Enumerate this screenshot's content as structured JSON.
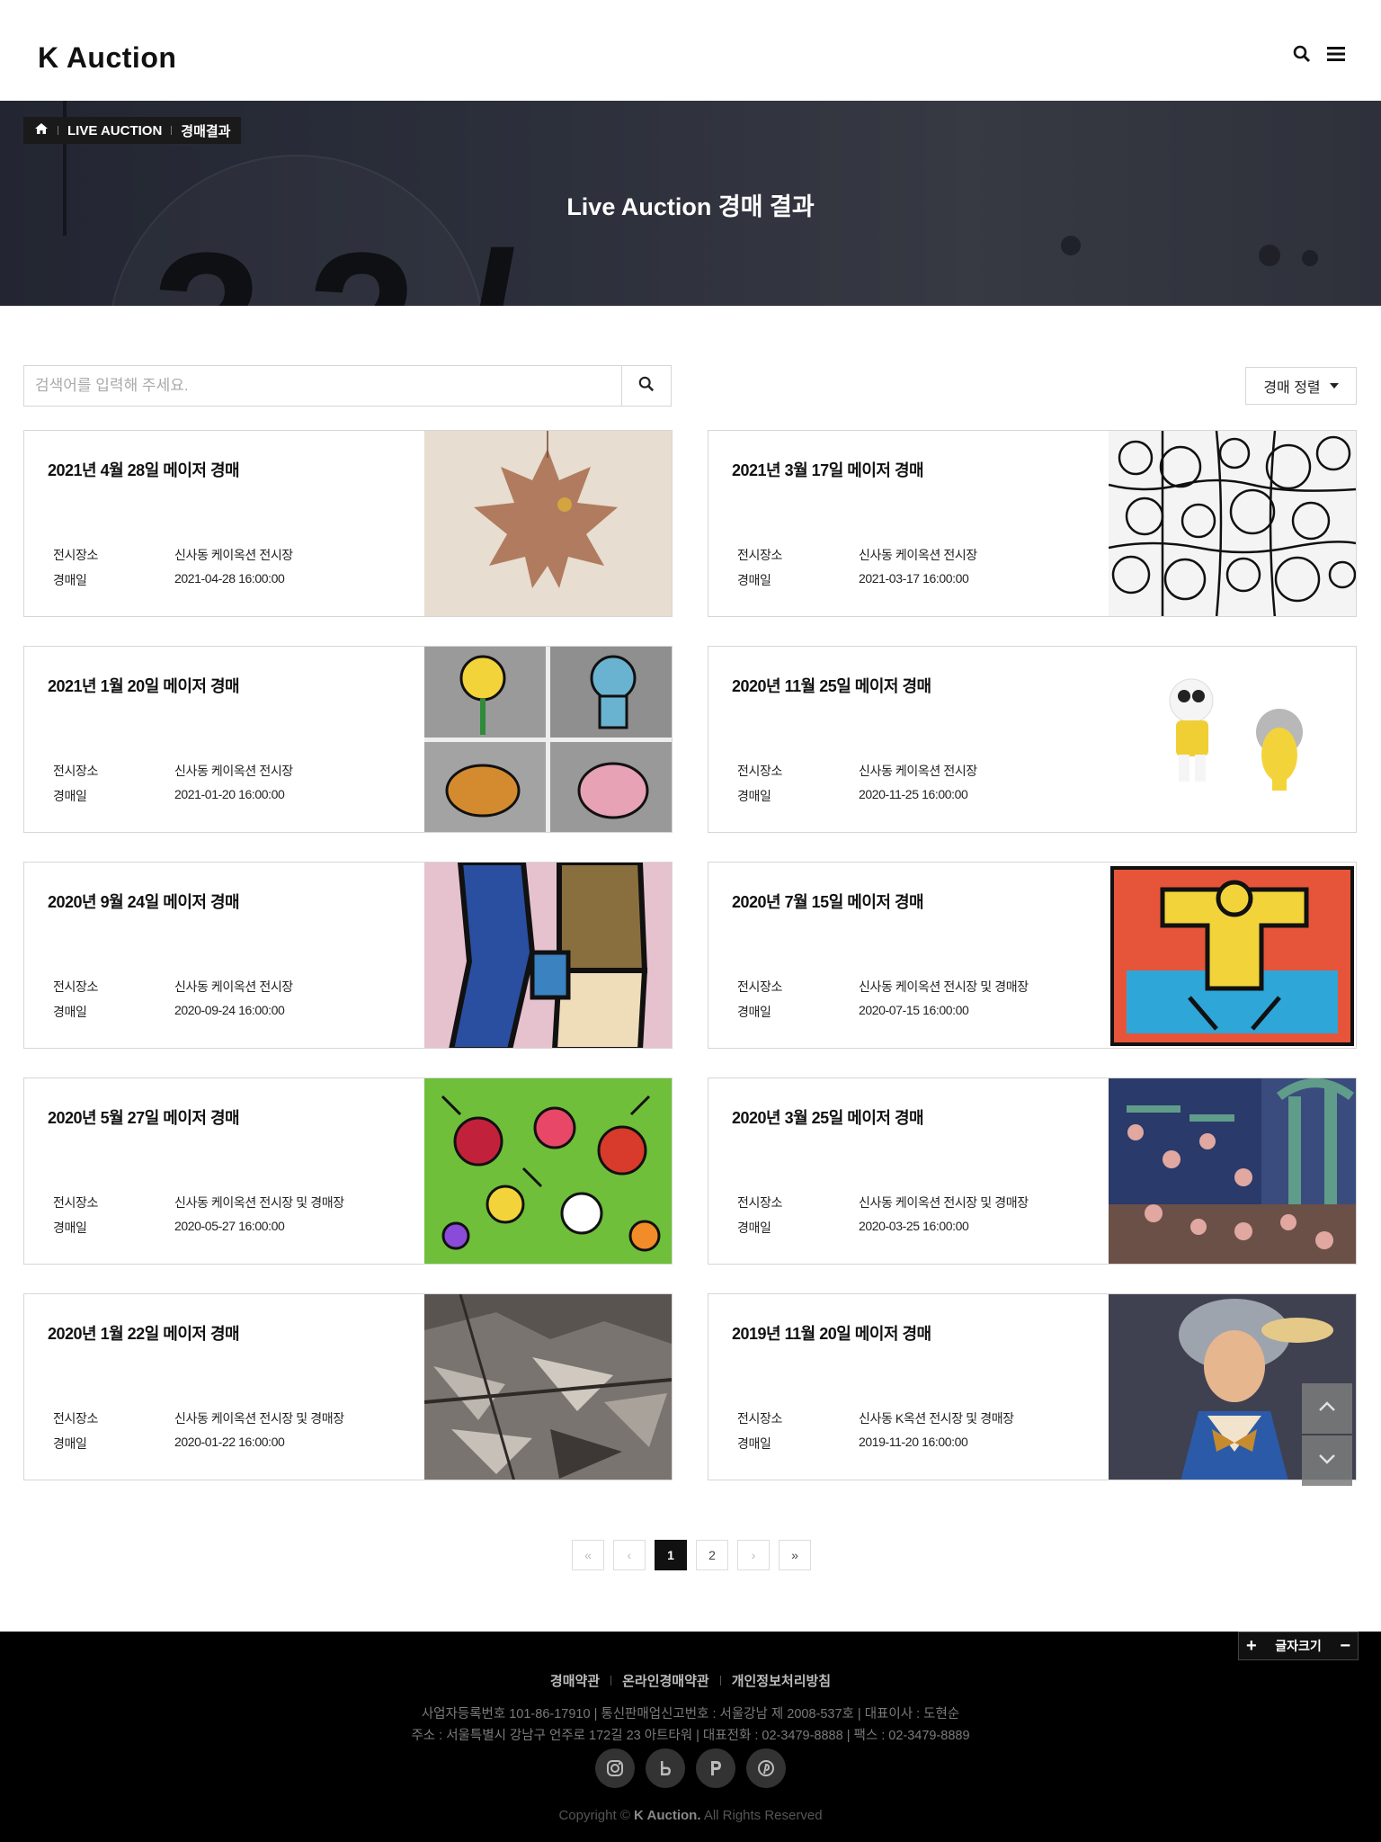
{
  "header": {
    "logo": "K Auction",
    "search_icon": "search-icon",
    "menu_icon": "hamburger-menu-icon"
  },
  "hero": {
    "breadcrumb": [
      "LIVE AUCTION",
      "경매결과"
    ],
    "home_icon": "home-icon",
    "title": "Live Auction 경매 결과"
  },
  "search": {
    "placeholder": "검색어를 입력해 주세요.",
    "button_icon": "search-icon"
  },
  "sort": {
    "label": "경매 정렬"
  },
  "labels": {
    "venue": "전시장소",
    "date": "경매일"
  },
  "auctions": [
    {
      "title": "2021년 4월 28일 메이저 경매",
      "venue": "신사동 케이옥션 전시장",
      "date": "2021-04-28 16:00:00"
    },
    {
      "title": "2021년 3월 17일 메이저 경매",
      "venue": "신사동 케이옥션 전시장",
      "date": "2021-03-17 16:00:00"
    },
    {
      "title": "2021년 1월 20일 메이저 경매",
      "venue": "신사동 케이옥션 전시장",
      "date": "2021-01-20 16:00:00"
    },
    {
      "title": "2020년 11월 25일 메이저 경매",
      "venue": "신사동 케이옥션 전시장",
      "date": "2020-11-25 16:00:00"
    },
    {
      "title": "2020년 9월 24일 메이저 경매",
      "venue": "신사동 케이옥션 전시장",
      "date": "2020-09-24 16:00:00"
    },
    {
      "title": "2020년 7월 15일 메이저 경매",
      "venue": "신사동 케이옥션 전시장 및 경매장",
      "date": "2020-07-15 16:00:00"
    },
    {
      "title": "2020년 5월 27일 메이저 경매",
      "venue": "신사동 케이옥션 전시장 및 경매장",
      "date": "2020-05-27 16:00:00"
    },
    {
      "title": "2020년 3월 25일 메이저 경매",
      "venue": "신사동 케이옥션 전시장 및 경매장",
      "date": "2020-03-25 16:00:00"
    },
    {
      "title": "2020년 1월 22일 메이저 경매",
      "venue": "신사동 케이옥션 전시장 및 경매장",
      "date": "2020-01-22 16:00:00"
    },
    {
      "title": "2019년 11월 20일 메이저 경매",
      "venue": "신사동 K옥션 전시장 및 경매장",
      "date": "2019-11-20 16:00:00"
    }
  ],
  "pagination": {
    "pages": [
      "1",
      "2"
    ],
    "current": "1",
    "first": "«",
    "prev": "‹",
    "next": "›",
    "last": "»"
  },
  "footer": {
    "fontsize_label": "글자크기",
    "fontsize_plus": "+",
    "fontsize_minus": "−",
    "links": [
      "경매약관",
      "온라인경매약관",
      "개인정보처리방침"
    ],
    "info_line1": "사업자등록번호 101-86-17910 | 통신판매업신고번호 : 서울강남 제 2008-537호 | 대표이사 : 도현순",
    "info_line2": "주소 : 서울특별시 강남구 언주로 172길 23 아트타워 | 대표전화 : 02-3479-8888 | 팩스 : 02-3479-8889",
    "socials": [
      "instagram-icon",
      "blog-icon",
      "post-icon",
      "pinterest-icon"
    ],
    "copyright_prefix": "Copyright ©",
    "copyright_brand": "K Auction.",
    "copyright_suffix": "All Rights Reserved"
  }
}
